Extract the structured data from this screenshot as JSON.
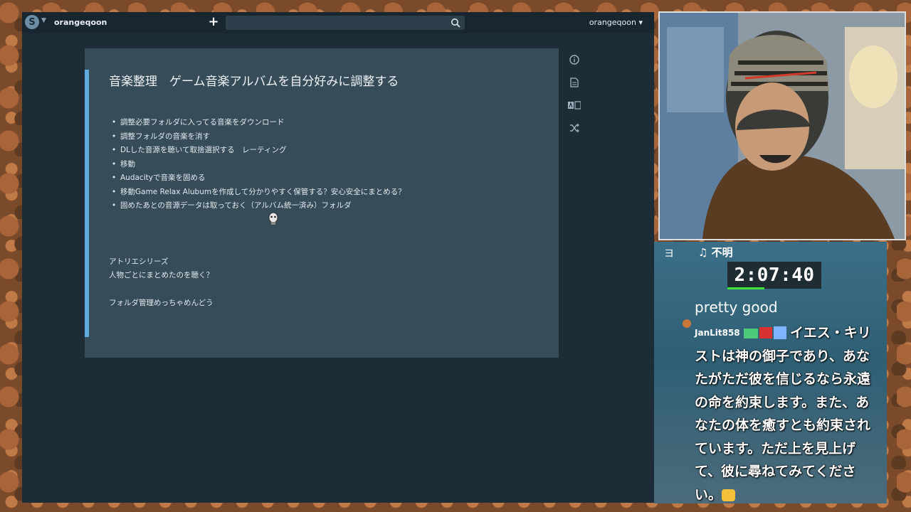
{
  "app": {
    "workspace": "orangeqoon",
    "user": "orangeqoon",
    "search": {
      "placeholder": "",
      "value": ""
    }
  },
  "note": {
    "title": "音楽整理　ゲーム音楽アルバムを自分好みに調整する",
    "bullets": [
      "調整必要フォルダに入ってる音楽をダウンロード",
      "調整フォルダの音楽を消す",
      "DLした音源を聴いて取捨選択する　レーティング",
      "移動",
      "Audacityで音楽を固める",
      "移動Game Relax Alubumを作成して分かりやすく保管する？安心安全にまとめる？",
      "固めたあとの音源データは取っておく（アルバム統一済み）フォルダ"
    ],
    "paragraphs": [
      "アトリエシリーズ",
      "人物ごとにまとめたのを聴く？",
      "フォルダ管理めっちゃめんどう"
    ]
  },
  "side_icons": [
    "info-icon",
    "document-icon",
    "translate-icon",
    "shuffle-icon"
  ],
  "stream": {
    "now_playing_icon": "ヨ",
    "now_playing": "♫ 不明",
    "timer": "2:07:40",
    "chat": [
      {
        "name": "",
        "text": "pretty good"
      },
      {
        "name": "JanLit858",
        "text": "イエス・キリストは神の御子であり、あなたがただ彼を信じるなら永遠の命を約束します。また、あなたの体を癒すとも約束されています。ただ上を見上げて、彼に尋ねてみてください。"
      }
    ]
  },
  "colors": {
    "app_bg": "#1d2d38",
    "topbar": "#182630",
    "card": "#364c59",
    "card_accent": "#5fa8e0",
    "timer_bar": "#3fe03a"
  }
}
